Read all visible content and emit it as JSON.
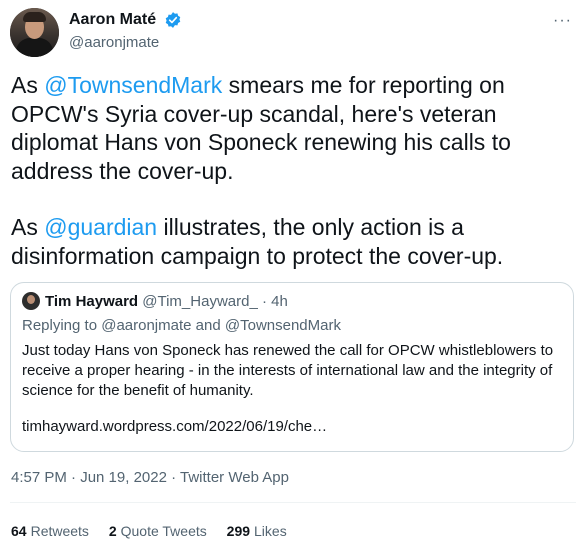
{
  "author": {
    "display_name": "Aaron Maté",
    "handle": "@aaronjmate"
  },
  "more_label": "···",
  "tweet": {
    "p1_before": "As ",
    "p1_mention": "@TownsendMark",
    "p1_after": " smears me for reporting on OPCW's Syria cover-up scandal, here's veteran diplomat Hans von Sponeck renewing his calls to address the cover-up.",
    "p2_before": "As ",
    "p2_mention": "@guardian",
    "p2_after": " illustrates, the only action is a disinformation campaign to protect the cover-up."
  },
  "quote": {
    "name": "Tim Hayward",
    "meta": "@Tim_Hayward_ · 4h",
    "reply_prefix": "Replying to ",
    "reply_user1": "@aaronjmate",
    "reply_and": " and ",
    "reply_user2": "@TownsendMark",
    "text": "Just today Hans von Sponeck has renewed the call for OPCW whistleblowers to receive a proper hearing - in the interests of international law and the integrity of science for the benefit of humanity.",
    "link": "timhayward.wordpress.com/2022/06/19/che…"
  },
  "timestamp": {
    "time": "4:57 PM · Jun 19, 2022 · ",
    "source": "Twitter Web App"
  },
  "stats": {
    "retweets_count": "64",
    "retweets_label": "Retweets",
    "quotes_count": "2",
    "quotes_label": "Quote Tweets",
    "likes_count": "299",
    "likes_label": "Likes"
  },
  "colors": {
    "accent": "#1d9bf0",
    "secondary_text": "#536471",
    "border": "#cfd9de"
  }
}
